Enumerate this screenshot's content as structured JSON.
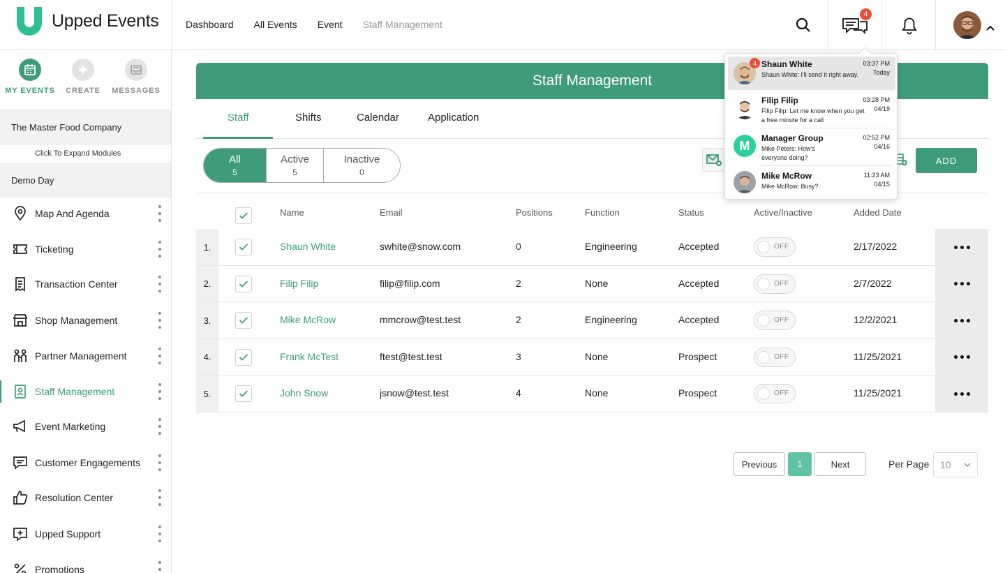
{
  "app": {
    "brand": "Upped Events",
    "accent_color": "#3e9c7a",
    "badge_color": "#e8503a"
  },
  "topnav": {
    "links": [
      "Dashboard",
      "All Events",
      "Event",
      "Staff Management"
    ],
    "message_badge": "4"
  },
  "sidebar": {
    "tabs": [
      {
        "label": "MY EVENTS",
        "icon": "calendar-icon"
      },
      {
        "label": "CREATE",
        "icon": "plus-icon"
      },
      {
        "label": "MESSAGES",
        "icon": "inbox-icon"
      }
    ],
    "org": "The Master Food Company",
    "expand_label": "Click To Expand Modules",
    "event": "Demo Day",
    "items": [
      {
        "label": "Map And Agenda",
        "icon": "map-pin-icon"
      },
      {
        "label": "Ticketing",
        "icon": "ticket-icon"
      },
      {
        "label": "Transaction Center",
        "icon": "receipt-icon"
      },
      {
        "label": "Shop Management",
        "icon": "store-icon"
      },
      {
        "label": "Partner Management",
        "icon": "partners-icon"
      },
      {
        "label": "Staff Management",
        "icon": "id-badge-icon"
      },
      {
        "label": "Event Marketing",
        "icon": "megaphone-icon"
      },
      {
        "label": "Customer Engagements",
        "icon": "chat-icon"
      },
      {
        "label": "Resolution Center",
        "icon": "thumbs-up-icon"
      },
      {
        "label": "Upped Support",
        "icon": "support-icon"
      },
      {
        "label": "Promotions",
        "icon": "percent-icon"
      }
    ]
  },
  "page": {
    "title": "Staff Management",
    "tabs": [
      "Staff",
      "Shifts",
      "Calendar",
      "Application"
    ],
    "filters": [
      {
        "label": "All",
        "count": "5"
      },
      {
        "label": "Active",
        "count": "5"
      },
      {
        "label": "Inactive",
        "count": "0"
      }
    ],
    "add_label": "ADD"
  },
  "table": {
    "columns": [
      "Name",
      "Email",
      "Positions",
      "Function",
      "Status",
      "Active/Inactive",
      "Added Date"
    ],
    "toggle_label": "OFF",
    "rows": [
      {
        "num": "1.",
        "name": "Shaun White",
        "email": "swhite@snow.com",
        "positions": "0",
        "function": "Engineering",
        "status": "Accepted",
        "added": "2/17/2022"
      },
      {
        "num": "2.",
        "name": "Filip Filip",
        "email": "filip@filip.com",
        "positions": "2",
        "function": "None",
        "status": "Accepted",
        "added": "2/7/2022"
      },
      {
        "num": "3.",
        "name": "Mike McRow",
        "email": "mmcrow@test.test",
        "positions": "2",
        "function": "Engineering",
        "status": "Accepted",
        "added": "12/2/2021"
      },
      {
        "num": "4.",
        "name": "Frank McTest",
        "email": "ftest@test.test",
        "positions": "3",
        "function": "None",
        "status": "Prospect",
        "added": "11/25/2021"
      },
      {
        "num": "5.",
        "name": "John Snow",
        "email": "jsnow@test.test",
        "positions": "4",
        "function": "None",
        "status": "Prospect",
        "added": "11/25/2021"
      }
    ]
  },
  "pagination": {
    "previous": "Previous",
    "current": "1",
    "next": "Next",
    "per_page_label": "Per Page",
    "per_page_value": "10"
  },
  "messages": [
    {
      "name": "Shaun White",
      "text": "Shaun White: I'll send it right away.",
      "time": "03:37 PM",
      "date": "Today",
      "badge": "4"
    },
    {
      "name": "Filip Filip",
      "text": "Filip Filip: Let me know when you get a free minute for a call",
      "time": "03:28 PM",
      "date": "04/19"
    },
    {
      "name": "Manager Group",
      "text": "Mike Peters: How's everyone doing?",
      "time": "02:52 PM",
      "date": "04/16",
      "initial": "M"
    },
    {
      "name": "Mike McRow",
      "text": "Mike McRow: Busy?",
      "time": "11:23 AM",
      "date": "04/15"
    }
  ]
}
